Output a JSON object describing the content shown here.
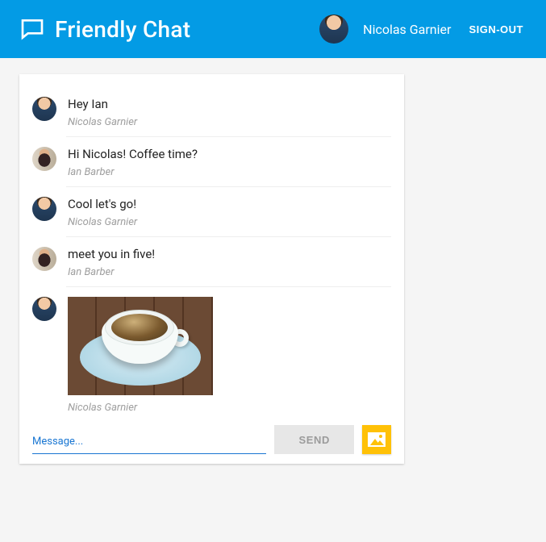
{
  "header": {
    "app_title": "Friendly Chat",
    "username": "Nicolas Garnier",
    "signout_label": "SIGN-OUT"
  },
  "messages": [
    {
      "author": "Nicolas Garnier",
      "avatar": "nicolas",
      "text": "Hey Ian",
      "type": "text"
    },
    {
      "author": "Ian Barber",
      "avatar": "ian",
      "text": "Hi Nicolas! Coffee time?",
      "type": "text"
    },
    {
      "author": "Nicolas Garnier",
      "avatar": "nicolas",
      "text": "Cool let's go!",
      "type": "text"
    },
    {
      "author": "Ian Barber",
      "avatar": "ian",
      "text": "meet you in five!",
      "type": "text"
    },
    {
      "author": "Nicolas Garnier",
      "avatar": "nicolas",
      "type": "image",
      "image_desc": "cup of coffee on wooden table"
    }
  ],
  "composer": {
    "placeholder": "Message...",
    "value": "",
    "send_label": "SEND"
  },
  "colors": {
    "primary": "#039BE5",
    "accent": "#FFC107"
  }
}
